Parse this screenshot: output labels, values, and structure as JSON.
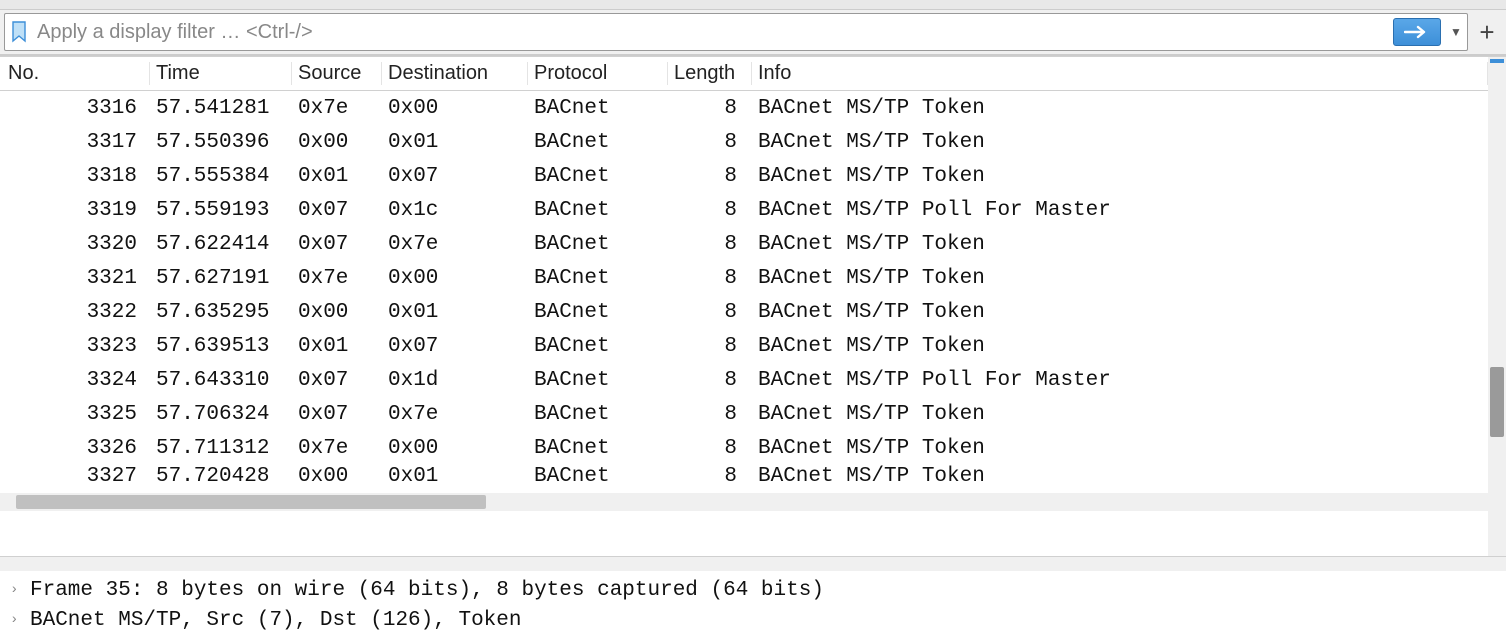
{
  "filter": {
    "placeholder": "Apply a display filter … <Ctrl-/>"
  },
  "columns": {
    "no": "No.",
    "time": "Time",
    "source": "Source",
    "destination": "Destination",
    "protocol": "Protocol",
    "length": "Length",
    "info": "Info"
  },
  "packets": [
    {
      "no": "3316",
      "time": "57.541281",
      "src": "0x7e",
      "dst": "0x00",
      "proto": "BACnet",
      "len": "8",
      "info": "BACnet MS/TP Token"
    },
    {
      "no": "3317",
      "time": "57.550396",
      "src": "0x00",
      "dst": "0x01",
      "proto": "BACnet",
      "len": "8",
      "info": "BACnet MS/TP Token"
    },
    {
      "no": "3318",
      "time": "57.555384",
      "src": "0x01",
      "dst": "0x07",
      "proto": "BACnet",
      "len": "8",
      "info": "BACnet MS/TP Token"
    },
    {
      "no": "3319",
      "time": "57.559193",
      "src": "0x07",
      "dst": "0x1c",
      "proto": "BACnet",
      "len": "8",
      "info": "BACnet MS/TP Poll For Master"
    },
    {
      "no": "3320",
      "time": "57.622414",
      "src": "0x07",
      "dst": "0x7e",
      "proto": "BACnet",
      "len": "8",
      "info": "BACnet MS/TP Token"
    },
    {
      "no": "3321",
      "time": "57.627191",
      "src": "0x7e",
      "dst": "0x00",
      "proto": "BACnet",
      "len": "8",
      "info": "BACnet MS/TP Token"
    },
    {
      "no": "3322",
      "time": "57.635295",
      "src": "0x00",
      "dst": "0x01",
      "proto": "BACnet",
      "len": "8",
      "info": "BACnet MS/TP Token"
    },
    {
      "no": "3323",
      "time": "57.639513",
      "src": "0x01",
      "dst": "0x07",
      "proto": "BACnet",
      "len": "8",
      "info": "BACnet MS/TP Token"
    },
    {
      "no": "3324",
      "time": "57.643310",
      "src": "0x07",
      "dst": "0x1d",
      "proto": "BACnet",
      "len": "8",
      "info": "BACnet MS/TP Poll For Master"
    },
    {
      "no": "3325",
      "time": "57.706324",
      "src": "0x07",
      "dst": "0x7e",
      "proto": "BACnet",
      "len": "8",
      "info": "BACnet MS/TP Token"
    },
    {
      "no": "3326",
      "time": "57.711312",
      "src": "0x7e",
      "dst": "0x00",
      "proto": "BACnet",
      "len": "8",
      "info": "BACnet MS/TP Token"
    },
    {
      "no": "3327",
      "time": "57.720428",
      "src": "0x00",
      "dst": "0x01",
      "proto": "BACnet",
      "len": "8",
      "info": "BACnet MS/TP Token"
    }
  ],
  "details": {
    "line1": "Frame 35: 8 bytes on wire (64 bits), 8 bytes captured (64 bits)",
    "line2": "BACnet MS/TP, Src (7), Dst (126), Token"
  }
}
